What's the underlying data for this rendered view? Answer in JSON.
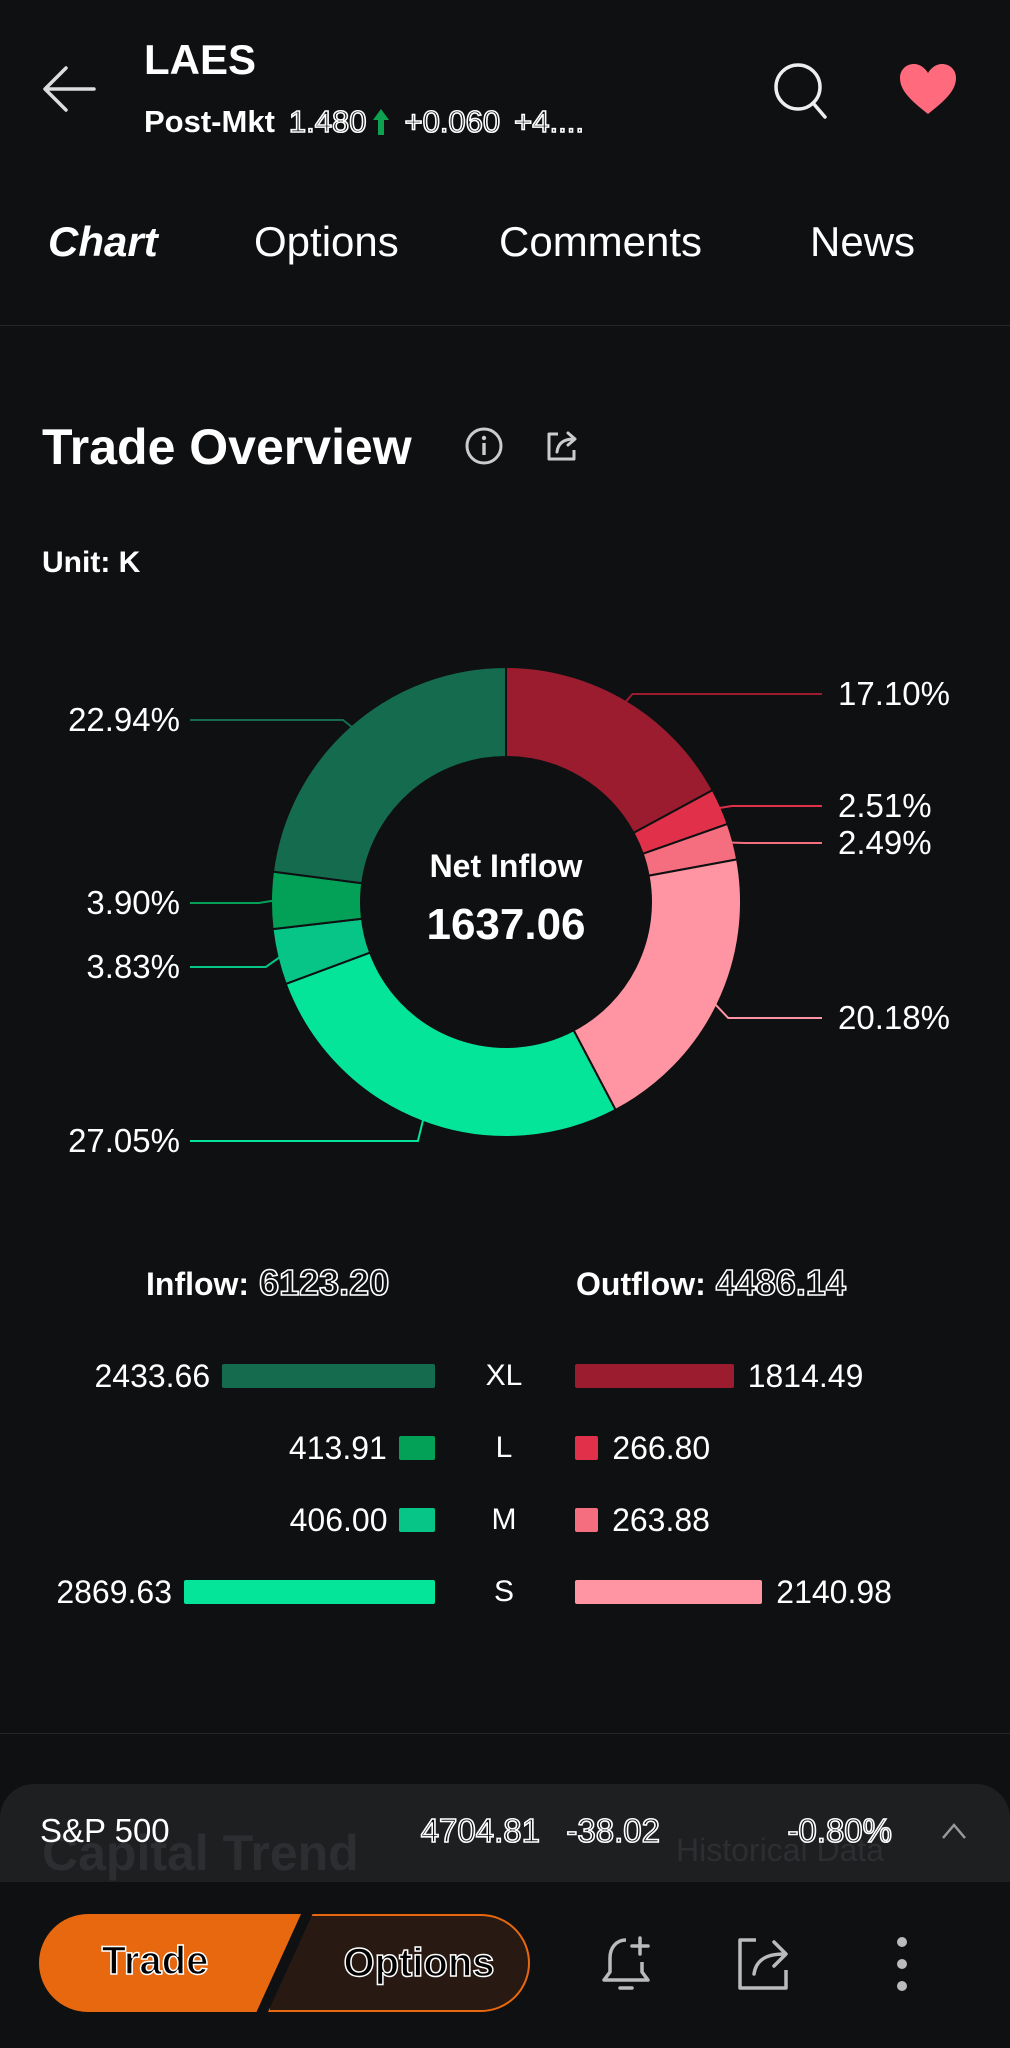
{
  "header": {
    "symbol": "LAES",
    "session_label": "Post-Mkt",
    "price": "1.480",
    "change": "+0.060",
    "change_pct": "+4....",
    "price_direction": "up",
    "up_color": "#0ea152",
    "favorite_color": "#ff6b7d"
  },
  "tabs": [
    {
      "label": "Chart",
      "active": true
    },
    {
      "label": "Options",
      "active": false
    },
    {
      "label": "Comments",
      "active": false
    },
    {
      "label": "News",
      "active": false
    }
  ],
  "section": {
    "title": "Trade Overview",
    "unit": "Unit: K",
    "icons": [
      "info-icon",
      "share-icon"
    ]
  },
  "chart_data": {
    "type": "pie",
    "variant": "donut",
    "center_label": "Net Inflow",
    "center_value": "1637.06",
    "slices": [
      {
        "label": "17.10%",
        "value": 17.1,
        "group": "outflow",
        "size": "XL",
        "color": "#9b1c2e"
      },
      {
        "label": "2.51%",
        "value": 2.51,
        "group": "outflow",
        "size": "L",
        "color": "#e0304a"
      },
      {
        "label": "2.49%",
        "value": 2.49,
        "group": "outflow",
        "size": "M",
        "color": "#f46e80"
      },
      {
        "label": "20.18%",
        "value": 20.18,
        "group": "outflow",
        "size": "S",
        "color": "#ff95a3"
      },
      {
        "label": "27.05%",
        "value": 27.05,
        "group": "inflow",
        "size": "S",
        "color": "#05e59a"
      },
      {
        "label": "3.83%",
        "value": 3.83,
        "group": "inflow",
        "size": "M",
        "color": "#07c586"
      },
      {
        "label": "3.90%",
        "value": 3.9,
        "group": "inflow",
        "size": "L",
        "color": "#02a157"
      },
      {
        "label": "22.94%",
        "value": 22.94,
        "group": "inflow",
        "size": "XL",
        "color": "#146b4e"
      }
    ]
  },
  "flows": {
    "inflow_label": "Inflow:",
    "inflow_total": "6123.20",
    "outflow_label": "Outflow:",
    "outflow_total": "4486.14",
    "rows": [
      {
        "size": "XL",
        "inflow": 2433.66,
        "inflow_text": "2433.66",
        "outflow": 1814.49,
        "outflow_text": "1814.49",
        "in_color": "#146b4e",
        "out_color": "#9b1c2e"
      },
      {
        "size": "L",
        "inflow": 413.91,
        "inflow_text": "413.91",
        "outflow": 266.8,
        "outflow_text": "266.80",
        "in_color": "#02a157",
        "out_color": "#e0304a"
      },
      {
        "size": "M",
        "inflow": 406.0,
        "inflow_text": "406.00",
        "outflow": 263.88,
        "outflow_text": "263.88",
        "in_color": "#07c586",
        "out_color": "#f46e80"
      },
      {
        "size": "S",
        "inflow": 2869.63,
        "inflow_text": "2869.63",
        "outflow": 2140.98,
        "outflow_text": "2140.98",
        "in_color": "#05e59a",
        "out_color": "#ff95a3"
      }
    ]
  },
  "ticker": {
    "name": "S&P 500",
    "value": "4704.81",
    "change": "-38.02",
    "change_pct": "-0.80%",
    "behind_title": "Capital Trend",
    "behind_link": "Historical Data"
  },
  "bottom_bar": {
    "trade_label": "Trade",
    "options_label": "Options",
    "accent": "#e8680f"
  }
}
